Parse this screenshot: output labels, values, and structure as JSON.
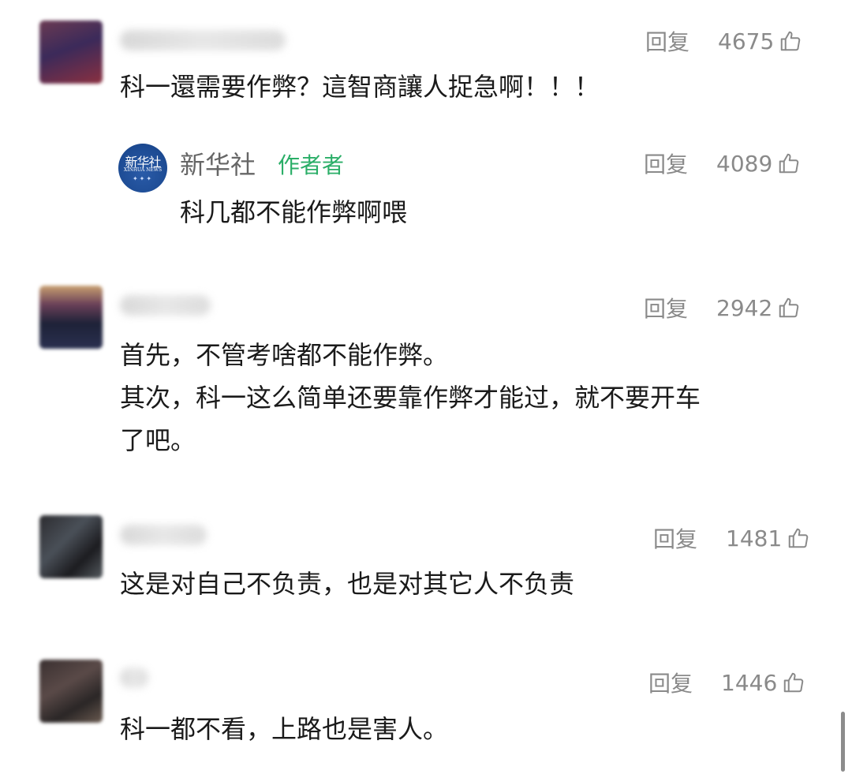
{
  "colors": {
    "text": "#1a1a1a",
    "meta": "#8a8a8a",
    "author_badge": "#2aae67",
    "sub_name": "#666666"
  },
  "comments": [
    {
      "reply_label": "回复",
      "likes": "4675",
      "text": "科一還需要作弊？這智商讓人捉急啊！！！",
      "reply": {
        "avatar_logo": "新华社",
        "avatar_logo_en": "XINHUA NEWS",
        "name": "新华社",
        "badge": "作者者",
        "reply_label": "回复",
        "likes": "4089",
        "text": "科几都不能作弊啊喂"
      }
    },
    {
      "reply_label": "回复",
      "likes": "2942",
      "text": "首先，不管考啥都不能作弊。\n其次，科一这么简单还要靠作弊才能过，就不要开车\n了吧。"
    },
    {
      "reply_label": "回复",
      "likes": "1481",
      "text": "这是对自己不负责，也是对其它人不负责"
    },
    {
      "reply_label": "回复",
      "likes": "1446",
      "text": "科一都不看，上路也是害人。"
    }
  ],
  "icons": {
    "like": "thumbs-up-icon"
  }
}
